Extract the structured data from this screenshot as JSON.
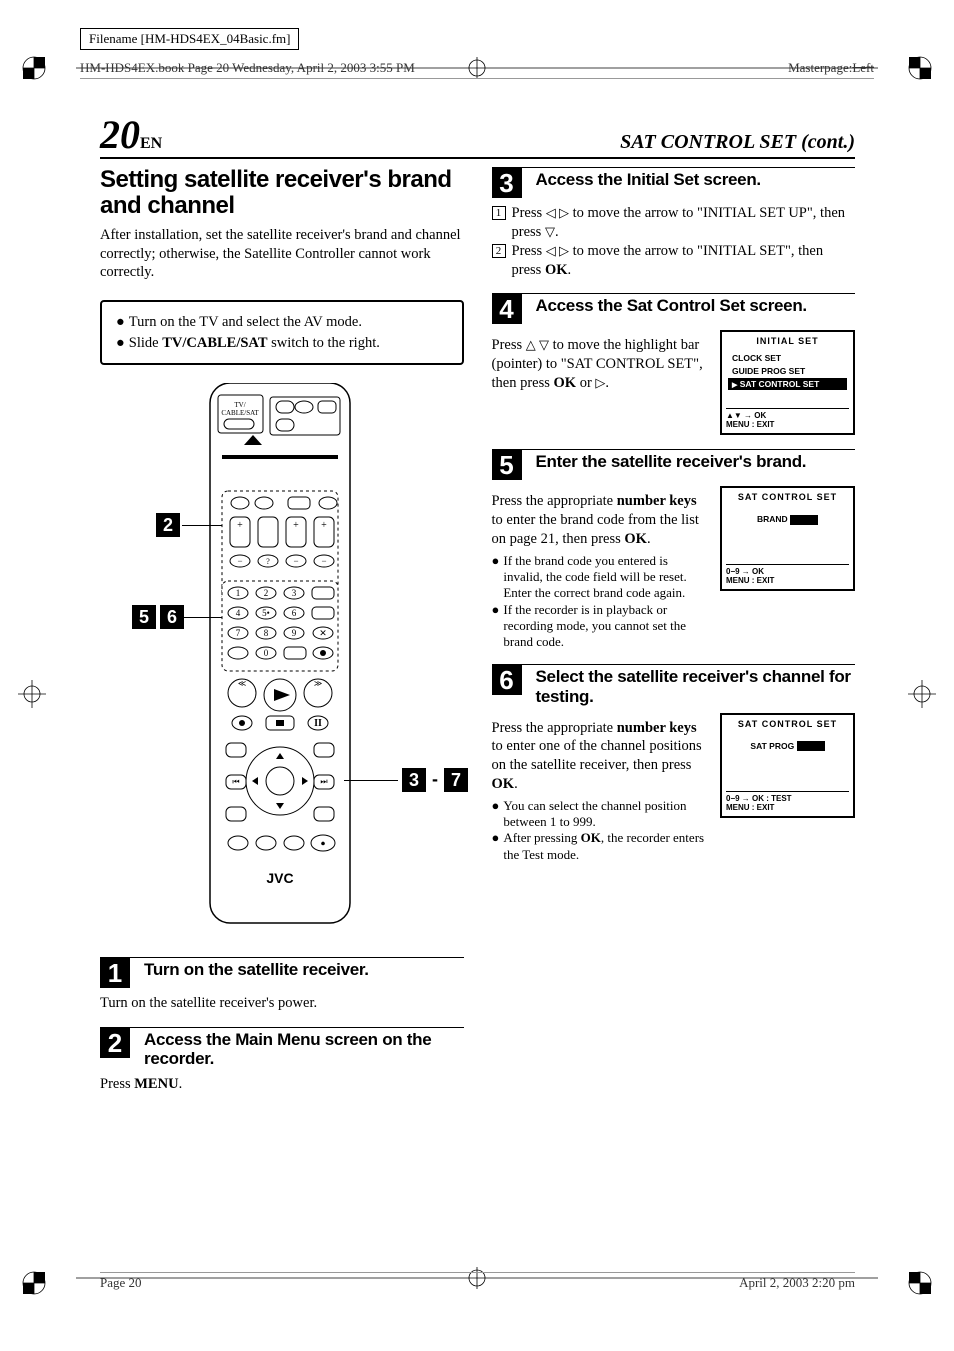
{
  "meta": {
    "filename_label": "Filename [HM-HDS4EX_04Basic.fm]",
    "book_line": "HM-HDS4EX.book  Page 20  Wednesday, April 2, 2003  3:55 PM",
    "masterpage_prefix": "Masterpage:",
    "masterpage_struck": "Left"
  },
  "title": {
    "page_num": "20",
    "en": "EN",
    "section": "SAT CONTROL SET (cont.)"
  },
  "left": {
    "heading": "Setting satellite receiver's brand and channel",
    "intro": "After installation, set the satellite receiver's brand and channel correctly; otherwise, the Satellite Controller cannot work correctly.",
    "prep1": "Turn on the TV and select the AV mode.",
    "prep2_a": "Slide ",
    "prep2_b": "TV/CABLE/SAT",
    "prep2_c": " switch to the right.",
    "remote_label": "TV/\nCABLE/SAT",
    "remote_brand": "JVC",
    "callouts": {
      "c2": "2",
      "c5": "5",
      "c6": "6",
      "c3": "3",
      "c7": "7",
      "dash": "-"
    },
    "step1_title": "Turn on the satellite receiver.",
    "step1_body": "Turn on the satellite receiver's power.",
    "step2_title": "Access the Main Menu screen on the recorder.",
    "step2_body_a": "Press ",
    "step2_body_b": "MENU",
    "step2_body_c": "."
  },
  "right": {
    "step3_title": "Access the Initial Set screen.",
    "step3_sub1_a": "Press ",
    "step3_sub1_b": " to move the arrow to \"INITIAL SET UP\", then press ",
    "step3_sub1_c": ".",
    "step3_sub2_a": "Press ",
    "step3_sub2_b": " to move the arrow to \"INITIAL SET\", then press ",
    "step3_sub2_c": "OK",
    "step3_sub2_d": ".",
    "step4_title": "Access the Sat Control Set screen.",
    "step4_body_a": "Press ",
    "step4_body_b": " to move the highlight bar (pointer) to \"SAT CONTROL SET\", then press ",
    "step4_body_c": "OK",
    "step4_body_d": " or ",
    "step4_body_e": ".",
    "screen4": {
      "header": "INITIAL SET",
      "line1": "CLOCK SET",
      "line2": "GUIDE PROG SET",
      "line3": "SAT CONTROL SET",
      "footer1": "▲▼ → OK",
      "footer2": "MENU : EXIT"
    },
    "step5_title": "Enter the satellite receiver's brand.",
    "step5_body_a": "Press the appropriate ",
    "step5_body_b": "number keys",
    "step5_body_c": " to enter the brand code from the list on page 21, then press ",
    "step5_body_d": "OK",
    "step5_body_e": ".",
    "step5_note1": "If the brand code you entered is invalid, the code field will be reset. Enter the correct brand code again.",
    "step5_note2": "If the recorder is in playback or recording mode, you cannot set the brand code.",
    "screen5": {
      "header": "SAT CONTROL SET",
      "label": "BRAND",
      "footer1": "0−9 → OK",
      "footer2": "MENU : EXIT"
    },
    "step6_title": "Select the satellite receiver's channel for testing.",
    "step6_body_a": "Press the appropriate ",
    "step6_body_b": "number keys",
    "step6_body_c": " to enter one of the channel positions on the satellite receiver, then press ",
    "step6_body_d": "OK",
    "step6_body_e": ".",
    "step6_note1": "You can select the channel position between 1 to 999.",
    "step6_note2_a": "After pressing ",
    "step6_note2_b": "OK",
    "step6_note2_c": ", the recorder enters the Test mode.",
    "screen6": {
      "header": "SAT CONTROL SET",
      "label": "SAT PROG",
      "footer1": "0−9 → OK : TEST",
      "footer2": "MENU : EXIT"
    }
  },
  "footer": {
    "page": "Page 20",
    "date": "April 2, 2003  2:20 pm"
  }
}
